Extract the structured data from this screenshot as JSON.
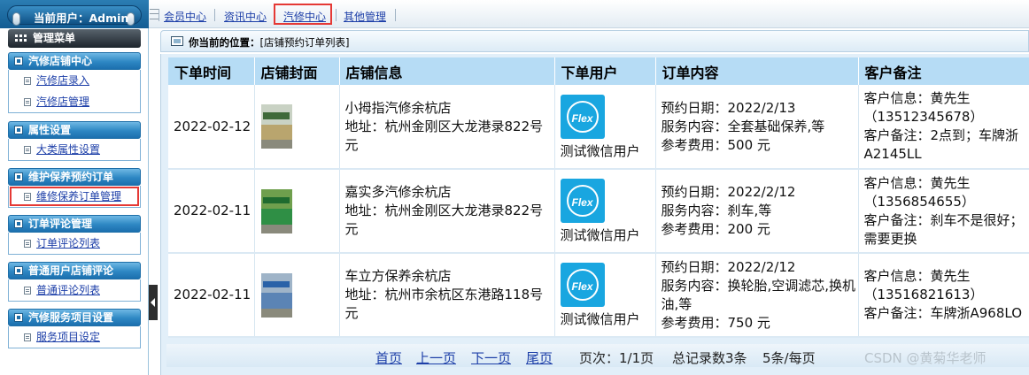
{
  "user": {
    "label": "当前用户：Admin"
  },
  "menu": {
    "title": "管理菜单"
  },
  "sidebar": {
    "groups": [
      {
        "title": "汽修店铺中心",
        "items": [
          "汽修店录入",
          "汽修店管理"
        ]
      },
      {
        "title": "属性设置",
        "items": [
          "大类属性设置"
        ]
      },
      {
        "title": "维护保养预约订单",
        "items": [
          "维修保养订单管理"
        ]
      },
      {
        "title": "订单评论管理",
        "items": [
          "订单评论列表"
        ]
      },
      {
        "title": "普通用户店铺评论",
        "items": [
          "普通评论列表"
        ]
      },
      {
        "title": "汽修服务项目设置",
        "items": [
          "服务项目设定"
        ]
      }
    ],
    "selected_item": "维修保养订单管理"
  },
  "topnav": {
    "items": [
      "会员中心",
      "资讯中心",
      "汽修中心",
      "其他管理"
    ],
    "active": "汽修中心"
  },
  "breadcrumb": {
    "label": "你当前的位置：",
    "path": "[店铺预约订单列表]"
  },
  "table": {
    "headers": [
      "下单时间",
      "店铺封面",
      "店铺信息",
      "下单用户",
      "订单内容",
      "客户备注"
    ],
    "rows": [
      {
        "date": "2022-02-12",
        "cover_colors": {
          "sky": "#c9d2c4",
          "bld": "#b9a56e",
          "sign": "#3f6a3a"
        },
        "shop_name": "小拇指汽修余杭店",
        "shop_addr": "地址：杭州金刚区大龙港录822号元",
        "user": "测试微信用户",
        "order_date": "预约日期：2022/2/13",
        "order_service": "服务内容：全套基础保养,等",
        "order_fee": "参考费用：500 元",
        "note_info": "客户信息：黄先生（13512345678）",
        "note_text": "客户备注：2点到；车牌浙A2145LL"
      },
      {
        "date": "2022-02-11",
        "cover_colors": {
          "sky": "#6f9f4d",
          "bld": "#2f8f45",
          "sign": "#1f6b2f"
        },
        "shop_name": "嘉实多汽修余杭店",
        "shop_addr": "地址：杭州金刚区大龙港录822号元",
        "user": "测试微信用户",
        "order_date": "预约日期：2022/2/12",
        "order_service": "服务内容：刹车,等",
        "order_fee": "参考费用：200 元",
        "note_info": "客户信息：黄先生（1356854655）",
        "note_text": "客户备注：刹车不是很好；需要更换"
      },
      {
        "date": "2022-02-11",
        "cover_colors": {
          "sky": "#9fb4c8",
          "bld": "#5b84b5",
          "sign": "#2a62a8"
        },
        "shop_name": "车立方保养余杭店",
        "shop_addr": "地址：杭州市余杭区东港路118号元",
        "user": "测试微信用户",
        "order_date": "预约日期：2022/2/12",
        "order_service": "服务内容：换轮胎,空调滤芯,换机油,等",
        "order_fee": "参考费用：750 元",
        "note_info": "客户信息：黄先生（13516821613）",
        "note_text": "客户备注：车牌浙A968LO"
      }
    ]
  },
  "pager": {
    "first": "首页",
    "prev": "上一页",
    "next": "下一页",
    "last": "尾页",
    "page_info": "页次：1/1页",
    "total": "总记录数3条",
    "per_page": "5条/每页"
  },
  "watermark": "CSDN @黄菊华老师",
  "colors": {
    "accent": "#1d3fa8",
    "highlight": "#e53935",
    "header_bg": "#b6dcf5"
  }
}
